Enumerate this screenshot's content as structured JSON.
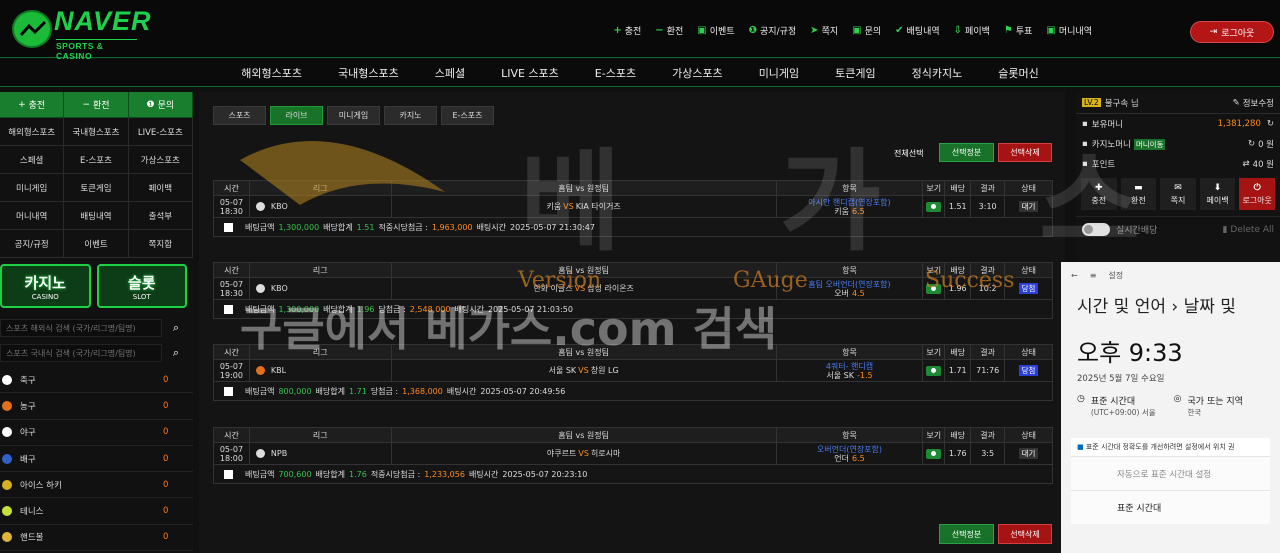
{
  "brand": {
    "name": "NAVER",
    "sub": "SPORTS & CASINO",
    "accent": "#1fd14a"
  },
  "top_menu": [
    {
      "icon": "plus-icon",
      "label": "충전"
    },
    {
      "icon": "minus-icon",
      "label": "환전"
    },
    {
      "icon": "calendar-icon",
      "label": "이벤트"
    },
    {
      "icon": "info-icon",
      "label": "공지/규정"
    },
    {
      "icon": "send-icon",
      "label": "쪽지"
    },
    {
      "icon": "question-icon",
      "label": "문의"
    },
    {
      "icon": "check-icon",
      "label": "배팅내역"
    },
    {
      "icon": "payback-icon",
      "label": "페이백"
    },
    {
      "icon": "vote-icon",
      "label": "투표"
    },
    {
      "icon": "money-icon",
      "label": "머니내역"
    }
  ],
  "logout_label": "로그아웃",
  "main_nav": [
    "해외형스포츠",
    "국내형스포츠",
    "스페셜",
    "LIVE 스포츠",
    "E-스포츠",
    "가상스포츠",
    "미니게임",
    "토큰게임",
    "정식카지노",
    "슬롯머신"
  ],
  "sidebar": {
    "top": [
      "충전",
      "환전",
      "문의"
    ],
    "grid": [
      "해외형스포츠",
      "국내형스포츠",
      "LIVE-스포츠",
      "스페셜",
      "E-스포츠",
      "가상스포츠",
      "미니게임",
      "토큰게임",
      "페이백",
      "머니내역",
      "배팅내역",
      "출석부",
      "공지/규정",
      "이벤트",
      "쪽지함"
    ],
    "banners": [
      {
        "big": "카지노",
        "small": "CASINO"
      },
      {
        "big": "슬롯",
        "small": "SLOT"
      }
    ],
    "search1": "스포츠 해외식 검색 (국가/리그명/팀명)",
    "search2": "스포츠 국내식 검색 (국가/리그명/팀명)",
    "sports": [
      {
        "name": "축구",
        "count": "0",
        "color": "#ffffff"
      },
      {
        "name": "농구",
        "count": "0",
        "color": "#e2701c"
      },
      {
        "name": "야구",
        "count": "0",
        "color": "#ffffff"
      },
      {
        "name": "배구",
        "count": "0",
        "color": "#2f62c8"
      },
      {
        "name": "아이스 하키",
        "count": "0",
        "color": "#d8b020"
      },
      {
        "name": "테니스",
        "count": "0",
        "color": "#c8e03a"
      },
      {
        "name": "핸드볼",
        "count": "0",
        "color": "#e0b43a"
      }
    ]
  },
  "tabs": [
    "스포츠",
    "라이브",
    "미니게임",
    "카지노",
    "E-스포츠"
  ],
  "select_all": "전체선택",
  "btn_select_bet": "선택정분",
  "btn_select_delete": "선택삭제",
  "headers": [
    "시간",
    "리그",
    "홈팀 vs 원정팀",
    "항목",
    "보기",
    "배당",
    "결과",
    "상태"
  ],
  "bets": [
    {
      "date": "05-07",
      "time": "18:30",
      "league": "KBO",
      "home": "키움",
      "vs": "VS",
      "away": "KIA 타이거즈",
      "pick1": "아시안 핸디캡(연장포함)",
      "pick2": "키움",
      "pick_val": "6.5",
      "odds": "1.51",
      "result": "3:10",
      "status": "대기",
      "f_amt_label": "배팅금액",
      "f_amt": "1,300,000",
      "f_odds_label": "배당합계",
      "f_odds": "1.51",
      "f_win_label": "적중시당첨금 :",
      "f_win": "1,963,000",
      "f_time_label": "배팅시간",
      "f_time": "2025-05-07 21:30:47"
    },
    {
      "date": "05-07",
      "time": "18:30",
      "league": "KBO",
      "home": "한화 이글스",
      "vs": "VS",
      "away": "삼성 라이온즈",
      "pick1": "홈팀 오버언더(연장포함)",
      "pick2": "오버",
      "pick_val": "4.5",
      "odds": "1.96",
      "result": "10:2",
      "status": "당첨",
      "f_amt_label": "배팅금액",
      "f_amt": "1,300,000",
      "f_odds_label": "배당합계",
      "f_odds": "1.96",
      "f_win_label": "당첨금 :",
      "f_win": "2,548,000",
      "f_time_label": "배팅시간",
      "f_time": "2025-05-07 21:03:50"
    },
    {
      "date": "05-07",
      "time": "19:00",
      "league": "KBL",
      "home": "서울 SK",
      "vs": "VS",
      "away": "창원 LG",
      "pick1": "4쿼터- 핸디캡",
      "pick2": "서울 SK",
      "pick_val": "-1.5",
      "odds": "1.71",
      "result": "71:76",
      "status": "당첨",
      "f_amt_label": "배팅금액",
      "f_amt": "800,000",
      "f_odds_label": "배당합계",
      "f_odds": "1.71",
      "f_win_label": "당첨금 :",
      "f_win": "1,368,000",
      "f_time_label": "배팅시간",
      "f_time": "2025-05-07 20:49:56"
    },
    {
      "date": "05-07",
      "time": "18:00",
      "league": "NPB",
      "home": "야쿠르트",
      "vs": "VS",
      "away": "히로시마",
      "pick1": "오버언더(연장포함)",
      "pick2": "언더",
      "pick_val": "6.5",
      "odds": "1.76",
      "result": "3:5",
      "status": "대기",
      "f_amt_label": "배팅금액",
      "f_amt": "700,600",
      "f_odds_label": "배당합계",
      "f_odds": "1.76",
      "f_win_label": "적중시당첨금 :",
      "f_win": "1,233,056",
      "f_time_label": "배팅시간",
      "f_time": "2025-05-07 20:23:10"
    }
  ],
  "rpanel": {
    "level": "LV.2",
    "user": "불구속 님",
    "info": "정보수정",
    "money_label": "보유머니",
    "money": "1,381,280",
    "casino_label": "카지노머니",
    "casino_btn": "머니이동",
    "casino_val": "0 원",
    "point_label": "포인트",
    "point_val": "40 원",
    "icons": [
      "충전",
      "환전",
      "쪽지",
      "페이백",
      "로그아웃"
    ],
    "realtime": "실시간배당",
    "delete_all": "Delete All"
  },
  "win": {
    "title": "설정",
    "heading": "시간 및 언어  ›  날짜 및",
    "time": "오후 9:33",
    "date": "2025년 5월 7일 수요일",
    "tz_label": "표준 시간대",
    "tz_val": "(UTC+09:00) 서울",
    "region_label": "국가 또는 지역",
    "region_val": "한국",
    "note": "표준 시간대 정확도를 개선하려면 설정에서 위치 권",
    "auto": "자동으로 표준 시간대 설정",
    "std": "표준 시간대"
  },
  "watermark": {
    "line1": "Version",
    "line2": "GAuge",
    "line3": "Success",
    "search": "구글에서 베가스.com 검색",
    "big": "베 가 스"
  }
}
